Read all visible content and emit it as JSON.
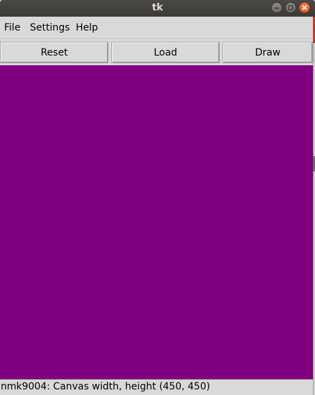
{
  "window": {
    "title": "tk"
  },
  "menubar": {
    "items": [
      {
        "label": "File"
      },
      {
        "label": "Settings"
      },
      {
        "label": "Help"
      }
    ]
  },
  "toolbar": {
    "reset_label": "Reset",
    "load_label": "Load",
    "draw_label": "Draw"
  },
  "canvas": {
    "background_color": "#800080"
  },
  "statusbar": {
    "text": "nmk9004: Canvas width, height (450, 450)"
  },
  "colors": {
    "canvas": "#800080",
    "close_button": "#e95420",
    "chrome": "#d9d9d9"
  }
}
